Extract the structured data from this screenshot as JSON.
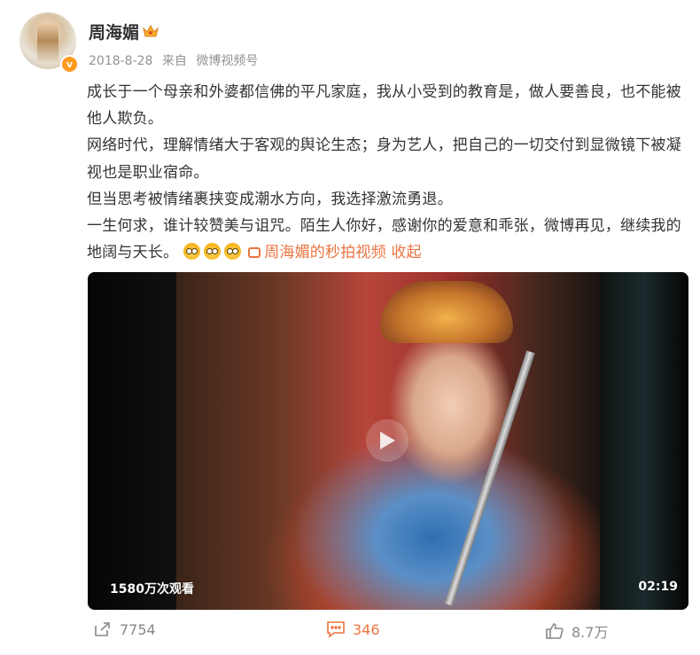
{
  "user": {
    "name": "周海媚",
    "verified_badge": "v",
    "crown_icon": "crown-icon"
  },
  "meta": {
    "date": "2018-8-28",
    "source_prefix": "来自",
    "source": "微博视频号"
  },
  "post": {
    "paragraphs": [
      "成长于一个母亲和外婆都信佛的平凡家庭，我从小受到的教育是，做人要善良，也不能被他人欺负。",
      "网络时代，理解情绪大于客观的舆论生态；身为艺人，把自己的一切交付到显微镜下被凝视也是职业宿命。",
      "但当思考被情绪裹挟变成潮水方向，我选择激流勇退。",
      "一生何求，谁计较赞美与诅咒。陌生人你好，感谢你的爱意和乖张，微博再见，继续我的地阔与天长。"
    ],
    "emoji_name": "doge-emoji",
    "video_link": "周海媚的秒拍视频",
    "collapse": "收起"
  },
  "video": {
    "views": "1580万次观看",
    "duration": "02:19"
  },
  "actions": {
    "repost": "7754",
    "comment": "346",
    "like": "8.7万"
  },
  "colors": {
    "accent": "#eb7340",
    "verified": "#ff9a1f",
    "muted": "#939393"
  }
}
